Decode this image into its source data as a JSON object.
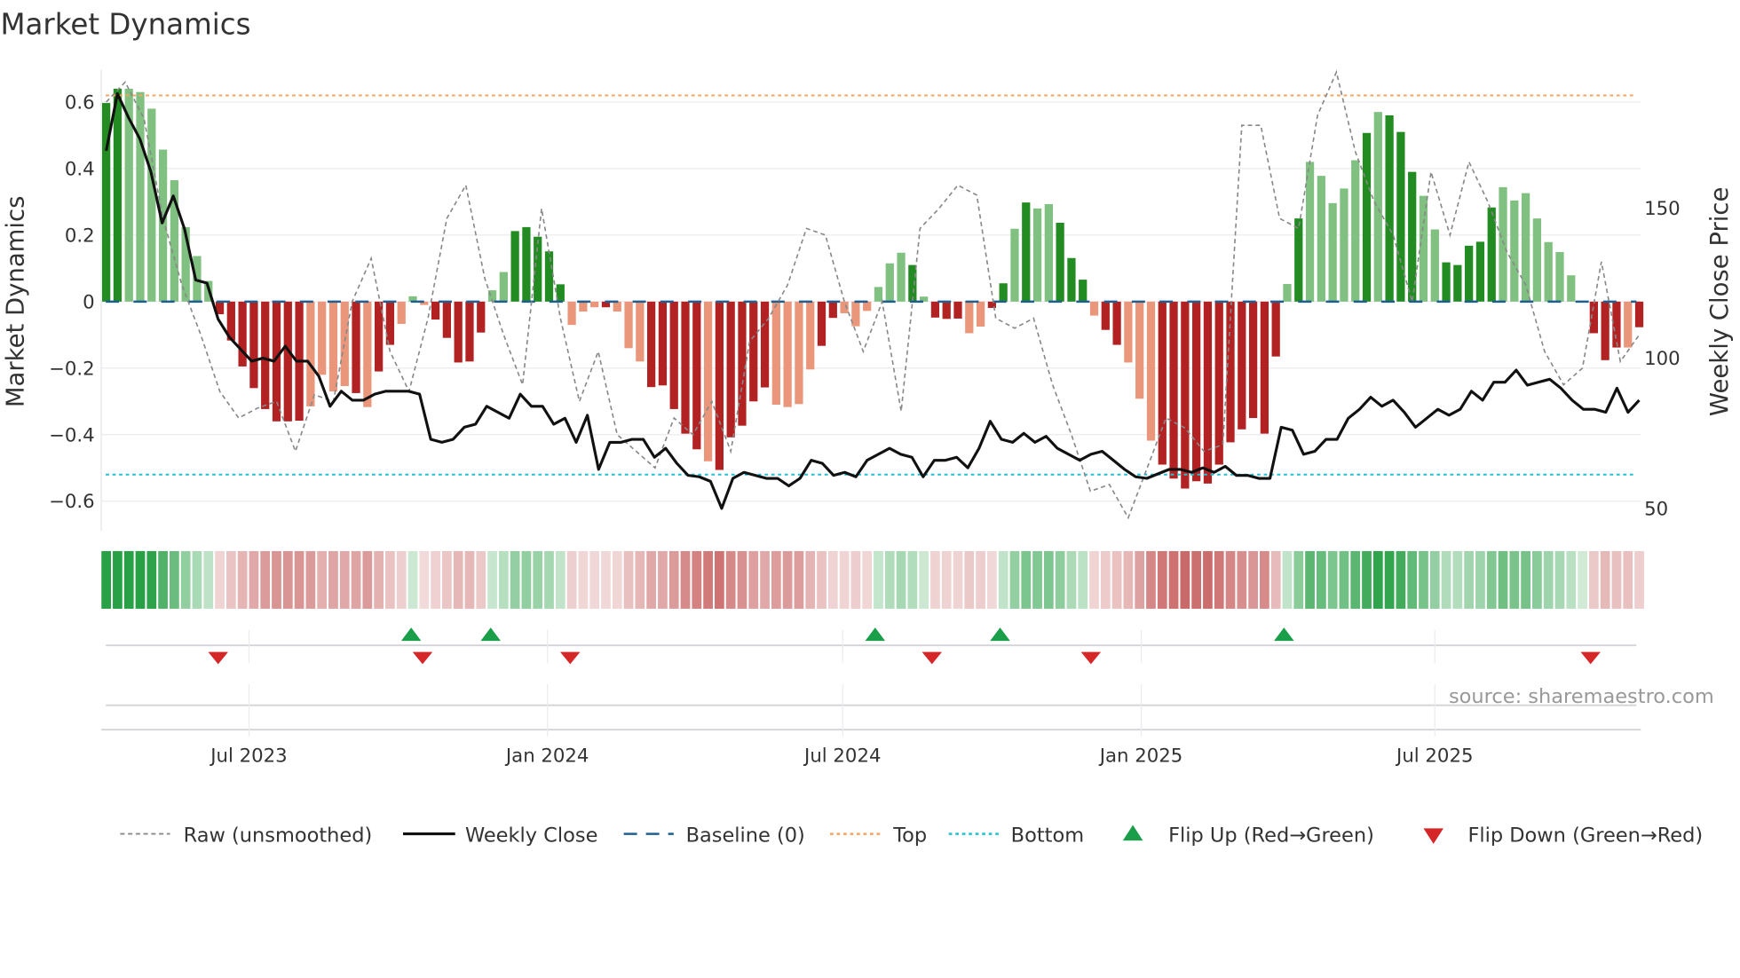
{
  "chart_data": {
    "type": "bar",
    "title": "Market Dynamics",
    "ylabel": "Market Dynamics",
    "y2label": "Weekly Close Price",
    "ylim": [
      -0.7,
      0.7
    ],
    "y2lim": [
      46,
      198
    ],
    "xlim": [
      "2023-04-01",
      "2025-11-05"
    ],
    "first_week": "2023-04-04",
    "yticks": [
      {
        "v": 0.6,
        "label": "0.6"
      },
      {
        "v": 0.4,
        "label": "0.4"
      },
      {
        "v": 0.2,
        "label": "0.2"
      },
      {
        "v": 0,
        "label": "0"
      },
      {
        "v": -0.2,
        "label": "−0.2"
      },
      {
        "v": -0.4,
        "label": "−0.4"
      },
      {
        "v": -0.6,
        "label": "−0.6"
      }
    ],
    "y2ticks": [
      {
        "v": 150,
        "label": "150"
      },
      {
        "v": 100,
        "label": "100"
      },
      {
        "v": 50,
        "label": "50"
      }
    ],
    "xticks": [
      {
        "date": "2023-07-01",
        "label": "Jul 2023"
      },
      {
        "date": "2024-01-01",
        "label": "Jan 2024"
      },
      {
        "date": "2024-07-01",
        "label": "Jul 2024"
      },
      {
        "date": "2025-01-01",
        "label": "Jan 2025"
      },
      {
        "date": "2025-07-01",
        "label": "Jul 2025"
      }
    ],
    "top_level": 0.62,
    "bottom_level": -0.52,
    "baseline": 0,
    "colors": {
      "up_strong": "#228b22",
      "up_weak": "#80c080",
      "down_strong": "#b22222",
      "down_weak": "#e9967a",
      "top": "#f4a460",
      "bottom": "#20c0d0",
      "baseline": "#1f5f8f",
      "raw": "#888888",
      "close": "#111111",
      "flip_up": "#1a9e4a",
      "flip_down": "#d62728"
    },
    "dynamics": [
      0.597,
      0.64,
      0.64,
      0.63,
      0.58,
      0.457,
      0.365,
      0.224,
      0.137,
      0.062,
      -0.038,
      -0.117,
      -0.195,
      -0.26,
      -0.323,
      -0.36,
      -0.36,
      -0.358,
      -0.315,
      -0.22,
      -0.27,
      -0.254,
      -0.275,
      -0.317,
      -0.21,
      -0.13,
      -0.067,
      0.016,
      -0.01,
      -0.054,
      -0.109,
      -0.183,
      -0.18,
      -0.093,
      0.034,
      0.089,
      0.212,
      0.224,
      0.195,
      0.151,
      0.052,
      -0.07,
      -0.03,
      -0.017,
      -0.017,
      -0.03,
      -0.14,
      -0.18,
      -0.257,
      -0.252,
      -0.323,
      -0.397,
      -0.444,
      -0.48,
      -0.506,
      -0.408,
      -0.373,
      -0.3,
      -0.258,
      -0.31,
      -0.317,
      -0.308,
      -0.204,
      -0.133,
      -0.049,
      -0.035,
      -0.074,
      -0.028,
      0.044,
      0.115,
      0.147,
      0.11,
      0.015,
      -0.048,
      -0.052,
      -0.051,
      -0.095,
      -0.075,
      -0.019,
      0.055,
      0.219,
      0.298,
      0.28,
      0.293,
      0.237,
      0.131,
      0.066,
      -0.042,
      -0.085,
      -0.13,
      -0.183,
      -0.292,
      -0.418,
      -0.49,
      -0.532,
      -0.562,
      -0.54,
      -0.547,
      -0.49,
      -0.423,
      -0.384,
      -0.35,
      -0.397,
      -0.165,
      0.053,
      0.25,
      0.42,
      0.378,
      0.296,
      0.34,
      0.425,
      0.507,
      0.57,
      0.56,
      0.51,
      0.39,
      0.318,
      0.217,
      0.118,
      0.11,
      0.168,
      0.18,
      0.283,
      0.344,
      0.304,
      0.326,
      0.25,
      0.179,
      0.149,
      0.079,
      0,
      -0.095,
      -0.176,
      -0.138,
      -0.138,
      -0.077
    ],
    "strength": "ddllllllllddddddddlllldlddllldddddlldddddllldllldddddldddddllllddlllllldl dddlldd ldlldddlddllldddddddddddldllllldldddlldddddllllllldddd ldllllldddldl",
    "raw": [
      0.6,
      0.66,
      0.55,
      0.25,
      0.05,
      -0.1,
      -0.27,
      -0.35,
      -0.32,
      -0.3,
      -0.45,
      -0.28,
      -0.3,
      0,
      0.13,
      -0.15,
      -0.27,
      -0.05,
      0.25,
      0.35,
      0.07,
      -0.1,
      -0.25,
      0.28,
      -0.05,
      -0.3,
      -0.15,
      -0.4,
      -0.45,
      -0.5,
      -0.35,
      -0.4,
      -0.3,
      -0.45,
      -0.12,
      -0.05,
      0.05,
      0.22,
      0.2,
      0,
      -0.15,
      0,
      -0.33,
      0.22,
      0.28,
      0.35,
      0.32,
      -0.05,
      -0.08,
      -0.05,
      -0.25,
      -0.4,
      -0.57,
      -0.55,
      -0.65,
      -0.5,
      -0.35,
      -0.38,
      -0.45,
      -0.43,
      0.53,
      0.53,
      0.25,
      0.22,
      0.56,
      0.69,
      0.45,
      0.3,
      0.2,
      0,
      0.39,
      0.2,
      0.42,
      0.3,
      0.15,
      0.05,
      -0.15,
      -0.25,
      -0.2,
      0.12,
      -0.18,
      -0.1
    ],
    "weekly_close": [
      169,
      188,
      180,
      173,
      162,
      145,
      154,
      143,
      126,
      125,
      113,
      107,
      103,
      99,
      100,
      99,
      104,
      99,
      99,
      94,
      84,
      89,
      86,
      86,
      88,
      89,
      89,
      89,
      88,
      73,
      72,
      73,
      77,
      78,
      84,
      82,
      80,
      88,
      84,
      84,
      78,
      80,
      72,
      81,
      63,
      72,
      72,
      73,
      73,
      67,
      70,
      65,
      61,
      60.5,
      59,
      50,
      60,
      62,
      61,
      60,
      60,
      57.5,
      60,
      66,
      65,
      61,
      62,
      60.5,
      66,
      68,
      70,
      68,
      67,
      60.5,
      66,
      66,
      67,
      63.5,
      70,
      79,
      73,
      72,
      75,
      72,
      74,
      70,
      68,
      66,
      68,
      69,
      66,
      63,
      60.5,
      60,
      61.5,
      63,
      63,
      62,
      63.5,
      62,
      64,
      61,
      61,
      60,
      60,
      77,
      76,
      68,
      69,
      73,
      73,
      80,
      83,
      87,
      84,
      86,
      82,
      77,
      80,
      83,
      81,
      83,
      89,
      86,
      92,
      92,
      96,
      91,
      92,
      93,
      90,
      86,
      83,
      83,
      82,
      90,
      82,
      86
    ],
    "flips_up": [
      "2023-10-09",
      "2023-11-27",
      "2024-07-21",
      "2024-10-06",
      "2025-03-30"
    ],
    "flips_down": [
      "2023-06-12",
      "2023-10-16",
      "2024-01-15",
      "2024-08-25",
      "2024-12-01",
      "2025-10-05"
    ],
    "legend": {
      "raw": "Raw (unsmoothed)",
      "close": "Weekly Close",
      "baseline": "Baseline (0)",
      "top": "Top",
      "bottom": "Bottom",
      "flip_up": "Flip Up (Red→Green)",
      "flip_down": "Flip Down (Green→Red)"
    },
    "source": "source: sharemaestro.com"
  }
}
